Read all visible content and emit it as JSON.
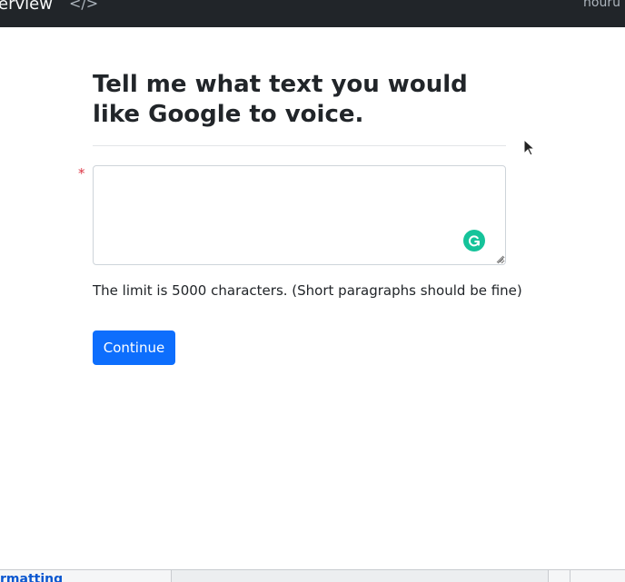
{
  "topbar": {
    "title": "erview",
    "code_icon": "</>",
    "right_text": "nouru"
  },
  "form": {
    "heading": "Tell me what text you would like Google to voice.",
    "required_mark": "*",
    "textarea_value": "",
    "helper_text": "The limit is 5000 characters. (Short paragraphs should be fine)",
    "submit_label": "Continue"
  },
  "bottom": {
    "link_text": "rmatting"
  },
  "colors": {
    "topbar_bg": "#212529",
    "primary_button": "#0d6efd",
    "required": "#dc3545",
    "grammarly": "#15c39a"
  }
}
